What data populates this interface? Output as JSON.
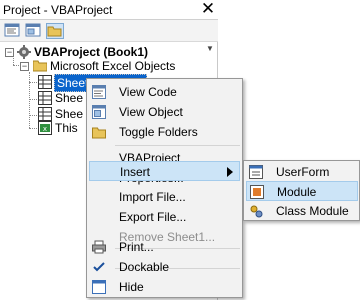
{
  "window": {
    "title": "Project - VBAProject",
    "close_glyph": "✕"
  },
  "toolbar": {
    "buttons": [
      {
        "name": "view-code-icon"
      },
      {
        "name": "view-object-icon"
      },
      {
        "name": "toggle-folders-icon",
        "pressed": true
      }
    ]
  },
  "tree": {
    "project": "VBAProject (Book1)",
    "folder": "Microsoft Excel Objects",
    "items": [
      {
        "label": "Sheet1 (Sheet1)",
        "visible": "Sheet1 (Sheet1)",
        "selected": true
      },
      {
        "label": "Sheet2 (Sheet2)",
        "visible": "Shee"
      },
      {
        "label": "Sheet3 (Sheet3)",
        "visible": "Shee"
      },
      {
        "label": "ThisWorkbook",
        "visible": "This"
      }
    ]
  },
  "context_menu": {
    "items": [
      {
        "label": "View Code",
        "icon": "view-code-icon"
      },
      {
        "label": "View Object",
        "icon": "view-object-icon"
      },
      {
        "label": "Toggle Folders",
        "icon": "folder-icon"
      },
      {
        "label": "VBAProject Properties..."
      },
      {
        "label": "Insert",
        "submenu": true,
        "highlighted": true
      },
      {
        "label": "Import File..."
      },
      {
        "label": "Export File..."
      },
      {
        "label": "Remove Sheet1...",
        "disabled": true
      },
      {
        "label": "Print...",
        "icon": "printer-icon"
      },
      {
        "label": "Dockable",
        "checked": true
      },
      {
        "label": "Hide",
        "icon": "hide-icon"
      }
    ]
  },
  "insert_submenu": {
    "items": [
      {
        "label": "UserForm",
        "icon": "userform-icon"
      },
      {
        "label": "Module",
        "icon": "module-icon",
        "highlighted": true
      },
      {
        "label": "Class Module",
        "icon": "class-module-icon"
      }
    ]
  },
  "colors": {
    "selection": "#0a64cc",
    "menu_highlight": "#cce4f7",
    "menu_bg": "#f2f2f2"
  }
}
